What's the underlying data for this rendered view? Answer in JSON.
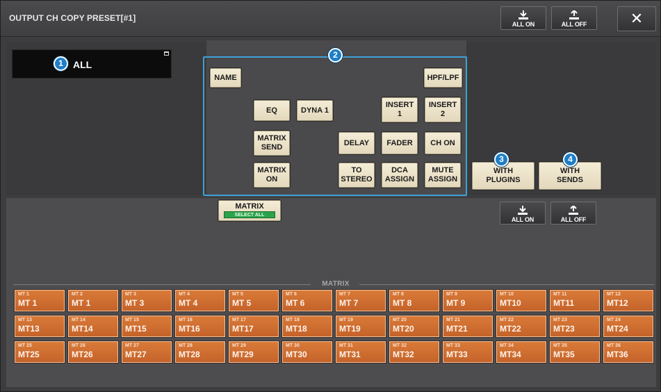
{
  "window": {
    "title": "OUTPUT CH COPY PRESET[#1]",
    "close_glyph": "✕"
  },
  "header_buttons": {
    "all_on": "ALL ON",
    "all_off": "ALL OFF"
  },
  "all_button": {
    "label": "ALL"
  },
  "callouts": [
    "1",
    "2",
    "3",
    "4"
  ],
  "params": {
    "name": "NAME",
    "hpf_lpf": "HPF/LPF",
    "eq": "EQ",
    "dyna1": "DYNA 1",
    "insert1": [
      "INSERT",
      "1"
    ],
    "insert2": [
      "INSERT",
      "2"
    ],
    "matrix_send": [
      "MATRIX",
      "SEND"
    ],
    "delay": "DELAY",
    "fader": "FADER",
    "ch_on": "CH ON",
    "matrix_on": [
      "MATRIX",
      "ON"
    ],
    "to_stereo": [
      "TO",
      "STEREO"
    ],
    "dca_assign": [
      "DCA",
      "ASSIGN"
    ],
    "mute_assign": [
      "MUTE",
      "ASSIGN"
    ]
  },
  "with_plugins": [
    "WITH",
    "PLUGINS"
  ],
  "with_sends": [
    "WITH",
    "SENDS"
  ],
  "matrix_section": {
    "title": "MATRIX",
    "select_all": "SELECT ALL",
    "group_label": "MATRIX",
    "all_on": "ALL ON",
    "all_off": "ALL OFF"
  },
  "channels": [
    {
      "small": "MT 1",
      "big": "MT 1"
    },
    {
      "small": "MT 2",
      "big": "MT 1"
    },
    {
      "small": "MT 3",
      "big": "MT 3"
    },
    {
      "small": "MT 4",
      "big": "MT 4"
    },
    {
      "small": "MT 5",
      "big": "MT 5"
    },
    {
      "small": "MT 6",
      "big": "MT 6"
    },
    {
      "small": "MT 7",
      "big": "MT 7"
    },
    {
      "small": "MT 8",
      "big": "MT 8"
    },
    {
      "small": "MT 9",
      "big": "MT 9"
    },
    {
      "small": "MT 10",
      "big": "MT10"
    },
    {
      "small": "MT 11",
      "big": "MT11"
    },
    {
      "small": "MT 12",
      "big": "MT12"
    },
    {
      "small": "MT 13",
      "big": "MT13"
    },
    {
      "small": "MT 14",
      "big": "MT14"
    },
    {
      "small": "MT 15",
      "big": "MT15"
    },
    {
      "small": "MT 16",
      "big": "MT16"
    },
    {
      "small": "MT 17",
      "big": "MT17"
    },
    {
      "small": "MT 18",
      "big": "MT18"
    },
    {
      "small": "MT 19",
      "big": "MT19"
    },
    {
      "small": "MT 20",
      "big": "MT20"
    },
    {
      "small": "MT 21",
      "big": "MT21"
    },
    {
      "small": "MT 22",
      "big": "MT22"
    },
    {
      "small": "MT 23",
      "big": "MT23"
    },
    {
      "small": "MT 24",
      "big": "MT24"
    },
    {
      "small": "MT 25",
      "big": "MT25"
    },
    {
      "small": "MT 26",
      "big": "MT26"
    },
    {
      "small": "MT 27",
      "big": "MT27"
    },
    {
      "small": "MT 28",
      "big": "MT28"
    },
    {
      "small": "MT 29",
      "big": "MT29"
    },
    {
      "small": "MT 30",
      "big": "MT30"
    },
    {
      "small": "MT 31",
      "big": "MT31"
    },
    {
      "small": "MT 32",
      "big": "MT32"
    },
    {
      "small": "MT 33",
      "big": "MT33"
    },
    {
      "small": "MT 34",
      "big": "MT34"
    },
    {
      "small": "MT 35",
      "big": "MT35"
    },
    {
      "small": "MT 36",
      "big": "MT36"
    }
  ],
  "colors": {
    "callout": "#1e7ec8",
    "param_button": "#efe6cf",
    "channel": "#d06e30",
    "select_all": "#2aa34a"
  }
}
